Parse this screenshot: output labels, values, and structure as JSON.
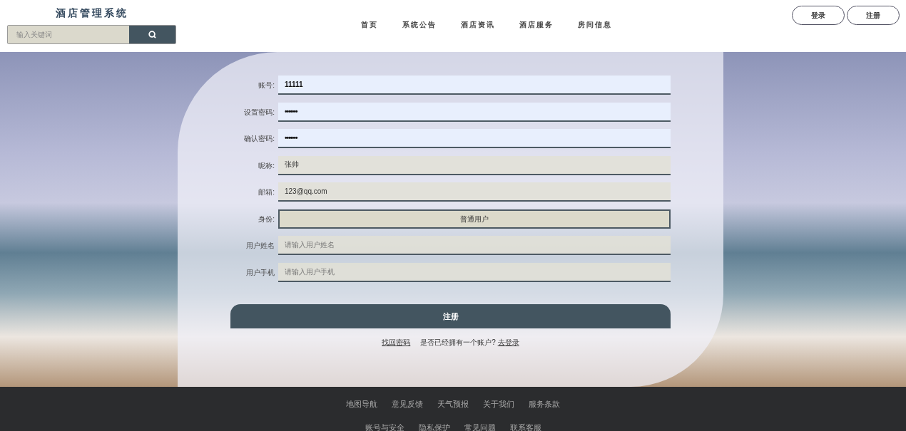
{
  "header": {
    "title": "酒店管理系统",
    "search": {
      "placeholder": "输入关键词"
    },
    "nav": [
      {
        "label": "首页"
      },
      {
        "label": "系统公告"
      },
      {
        "label": "酒店资讯"
      },
      {
        "label": "酒店服务"
      },
      {
        "label": "房间信息"
      }
    ],
    "buttons": [
      {
        "label": "登录"
      },
      {
        "label": "注册"
      }
    ]
  },
  "form": {
    "fields": [
      {
        "label": "账号:",
        "kind": "text",
        "value": "11111",
        "filled": true
      },
      {
        "label": "设置密码:",
        "kind": "password",
        "value": "•••••••",
        "filled": true
      },
      {
        "label": "确认密码:",
        "kind": "password",
        "value": "•••••••",
        "filled": true
      },
      {
        "label": "昵称:",
        "kind": "text",
        "value": "张帅",
        "filled": false
      },
      {
        "label": "邮箱:",
        "kind": "text",
        "value": "123@qq.com",
        "filled": false
      },
      {
        "label": "身份:",
        "kind": "select",
        "value": "普通用户"
      },
      {
        "label": "用户姓名",
        "kind": "text",
        "placeholder": "请输入用户姓名",
        "filled": false
      },
      {
        "label": "用户手机",
        "kind": "text",
        "placeholder": "请输入用户手机",
        "filled": false
      }
    ],
    "submit": "注册",
    "forgot_link": "找回密码",
    "question": "是否已经拥有一个账户?",
    "login_link": "去登录"
  },
  "footer": {
    "rows": [
      [
        "地图导航",
        "意见反馈",
        "天气预报",
        "关于我们",
        "服务条款"
      ],
      [
        "账号与安全",
        "隐私保护",
        "常见问题",
        "联系客服"
      ]
    ]
  }
}
